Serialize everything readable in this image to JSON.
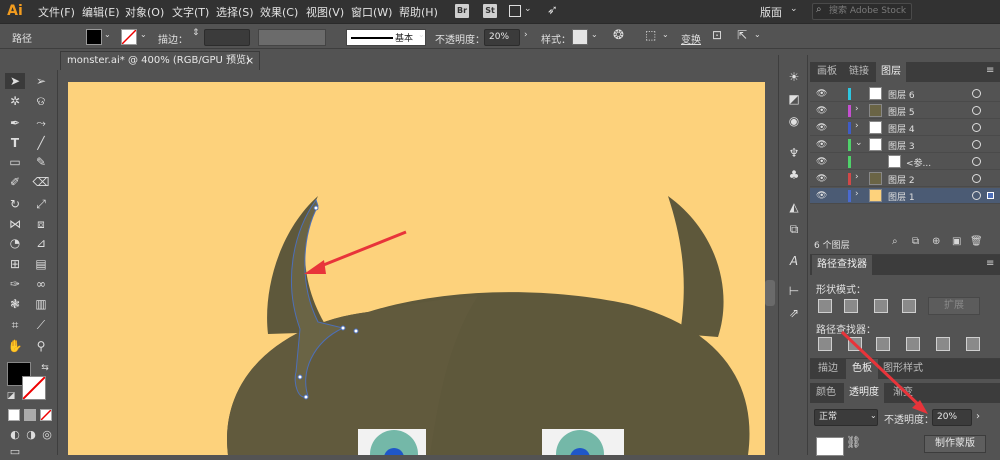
{
  "app": {
    "logo": "Ai"
  },
  "menu": [
    "文件(F)",
    "编辑(E)",
    "对象(O)",
    "文字(T)",
    "选择(S)",
    "效果(C)",
    "视图(V)",
    "窗口(W)",
    "帮助(H)"
  ],
  "app_buttons": [
    "Br",
    "St"
  ],
  "workspace": "版面",
  "search_placeholder": "搜索 Adobe Stock",
  "control": {
    "mode_label": "路径",
    "stroke_label": "描边：",
    "stroke_style": "基本",
    "opacity_label": "不透明度：",
    "opacity_value": "20%",
    "style_label": "样式：",
    "transform_label": "变换"
  },
  "document_tab": "monster.ai* @ 400% (RGB/GPU 预览)",
  "colors": {
    "artboard": "#fdd27c",
    "monster": "#5e583b",
    "arrow": "#e8343a",
    "selection": "#4d6fb8"
  },
  "layers_panel": {
    "tabs": [
      "画板",
      "链接",
      "图层"
    ],
    "active_tab": "图层",
    "rows": [
      {
        "name": "图层 6",
        "color": "#2ec6e0",
        "expanded": false,
        "has_caret": false
      },
      {
        "name": "图层 5",
        "color": "#c54fd0",
        "expanded": false,
        "has_caret": true
      },
      {
        "name": "图层 4",
        "color": "#3f5cc6",
        "expanded": false,
        "has_caret": true
      },
      {
        "name": "图层 3",
        "color": "#4fd16a",
        "expanded": true,
        "has_caret": true
      },
      {
        "name": "<参...",
        "color": "#4fd16a",
        "expanded": false,
        "has_caret": false
      },
      {
        "name": "图层 2",
        "color": "#d14848",
        "expanded": false,
        "has_caret": true
      },
      {
        "name": "图层 1",
        "color": "#4a6ad0",
        "expanded": false,
        "has_caret": true
      }
    ],
    "footer": "6 个图层"
  },
  "pathfinder": {
    "title": "路径查找器",
    "shape_modes": "形状模式：",
    "expand": "扩展",
    "pathfinders": "路径查找器："
  },
  "bottom_panel": {
    "tabs_row1": [
      "描边",
      "色板",
      "图形样式"
    ],
    "tabs_row2": [
      "颜色",
      "透明度",
      "渐变"
    ],
    "blend_mode": "正常",
    "opacity_label": "不透明度：",
    "opacity_value": "20%",
    "make_mask": "制作蒙版"
  }
}
